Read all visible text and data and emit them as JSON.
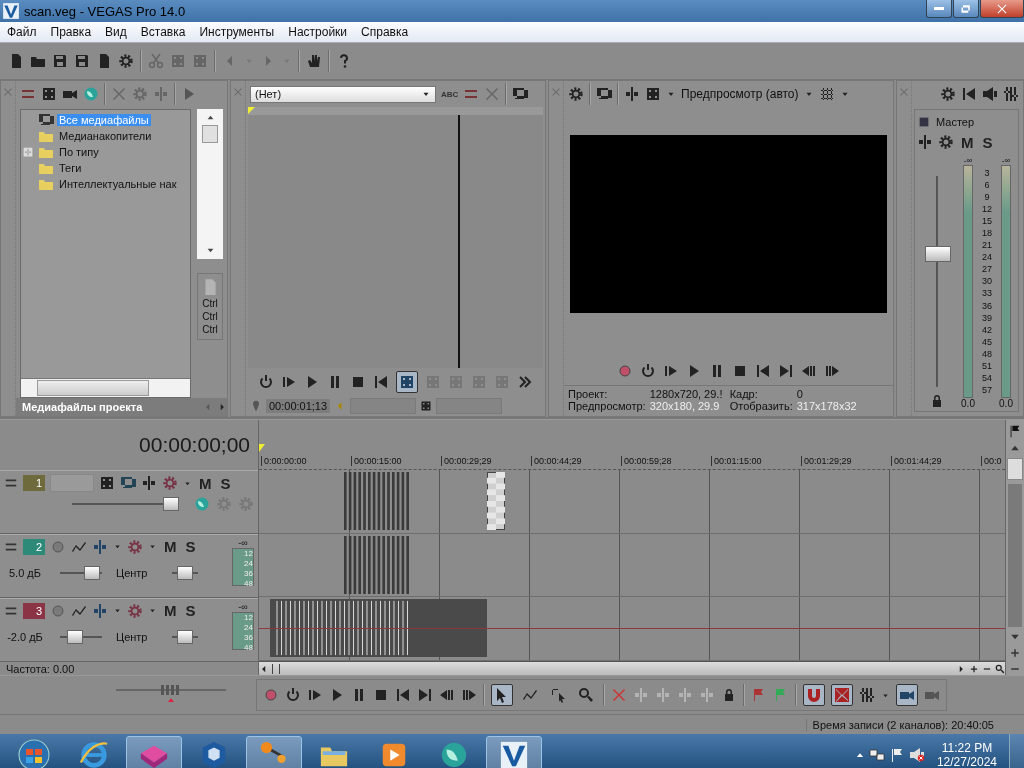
{
  "window": {
    "title": "scan.veg - VEGAS Pro 14.0"
  },
  "menu": [
    "Файл",
    "Правка",
    "Вид",
    "Вставка",
    "Инструменты",
    "Настройки",
    "Справка"
  ],
  "media_panel": {
    "tree": [
      {
        "label": "Все медиафайлы",
        "kind": "media",
        "selected": true,
        "collapsed": false
      },
      {
        "label": "Медианакопители",
        "kind": "folder",
        "selected": false,
        "collapsed": false
      },
      {
        "label": "По типу",
        "kind": "folder",
        "selected": false,
        "collapsed": true
      },
      {
        "label": "Теги",
        "kind": "folder",
        "selected": false,
        "collapsed": false
      },
      {
        "label": "Интеллектуальные нак",
        "kind": "folder",
        "selected": false,
        "collapsed": false
      }
    ],
    "side_labels": [
      "Ctrl",
      "Ctrl",
      "Ctrl"
    ],
    "tab": "Медиафайлы проекта"
  },
  "trimmer": {
    "dropdown": "(Нет)",
    "abc_button": "ABC",
    "timecode": "00:00:01;13"
  },
  "preview": {
    "mode": "Предпросмотр (авто)",
    "info": [
      {
        "label": "Проект:",
        "value": "1280x720, 29.!"
      },
      {
        "label": "Кадр:",
        "value": "0"
      },
      {
        "label": "Предпросмотр:",
        "value": "320x180, 29.9"
      },
      {
        "label": "Отобразить:",
        "value": "317x178x32"
      }
    ]
  },
  "master": {
    "title": "Мастер",
    "mute": "M",
    "solo": "S",
    "fader": {
      "level": 0.63
    },
    "meter_tops": [
      "-∞",
      "-∞"
    ],
    "scale": [
      "3",
      "6",
      "9",
      "12",
      "15",
      "18",
      "21",
      "24",
      "27",
      "30",
      "33",
      "36",
      "39",
      "42",
      "45",
      "48",
      "51",
      "54",
      "57"
    ],
    "readings": [
      "0.0",
      "0.0"
    ]
  },
  "timeline": {
    "timecode": "00:00:00;00",
    "ruler": [
      "0:00:00:00",
      "00:00:15:00",
      "00:00:29;29",
      "00:00:44;29",
      "00:00:59;28",
      "00:01:15:00",
      "00:01:29;29",
      "00:01:44;29",
      "00:0"
    ],
    "tracks": [
      {
        "kind": "video",
        "number": "1",
        "color": "#6e6a3c",
        "mute": "M",
        "solo": "S",
        "opacity": {
          "level": 0.95
        }
      },
      {
        "kind": "audio",
        "number": "2",
        "color": "#2e8a78",
        "mute": "M",
        "solo": "S",
        "volume": {
          "reading": "5.0 дБ",
          "level": 0.75
        },
        "pan": {
          "reading": "Центр",
          "level": 0.5
        },
        "meter_top": "-∞",
        "meter_scale": [
          "12",
          "24",
          "36",
          "48"
        ]
      },
      {
        "kind": "audio",
        "number": "3",
        "color": "#8a3446",
        "mute": "M",
        "solo": "S",
        "volume": {
          "reading": "-2.0 дБ",
          "level": 0.35
        },
        "pan": {
          "reading": "Центр",
          "level": 0.5
        },
        "meter_top": "-∞",
        "meter_scale": [
          "12",
          "24",
          "36",
          "48"
        ]
      }
    ]
  },
  "rate": "Частота: 0.00",
  "rate_slider": {
    "level": 0.5
  },
  "tools": [
    {
      "kind": "cursor",
      "on": true
    },
    {
      "kind": "envelope",
      "on": false
    },
    {
      "kind": "select",
      "on": false
    },
    {
      "kind": "zoom",
      "on": false
    }
  ],
  "snap_tools": [
    {
      "kind": "magnet",
      "on": true
    },
    {
      "kind": "ripple",
      "on": true
    }
  ],
  "status": "Время записи (2 каналов): 20:40:05",
  "taskbar": {
    "apps": [
      {
        "kind": "browser",
        "open": false
      },
      {
        "kind": "cube",
        "open": true
      },
      {
        "kind": "box",
        "open": false
      },
      {
        "kind": "pin",
        "open": true
      },
      {
        "kind": "folder",
        "open": false
      },
      {
        "kind": "player",
        "open": false
      },
      {
        "kind": "globe",
        "open": false
      },
      {
        "kind": "editor",
        "open": true
      }
    ],
    "time": "11:22 PM",
    "date": "12/27/2024"
  }
}
